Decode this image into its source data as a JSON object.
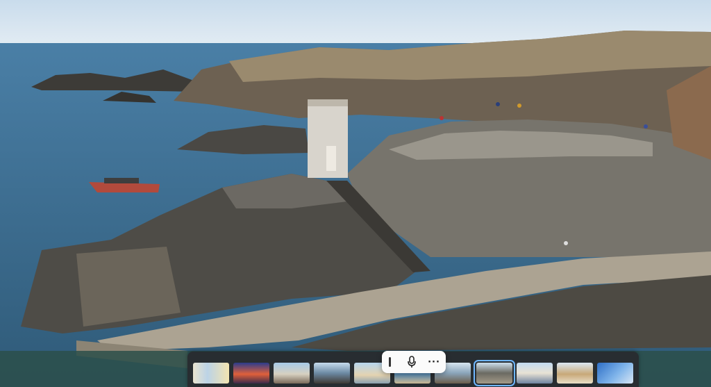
{
  "viewer": {
    "photo_icon": "landscape-photo",
    "colors": {
      "sky": "#dde9f3",
      "sea": "#3f6f94",
      "rock": "#5b5a55",
      "quay": "#a89f8f",
      "filmstrip_bg": "#28282c",
      "selection_outline": "#6fb7ff"
    }
  },
  "voice_toolbar": {
    "handle_icon": "drag-handle-icon",
    "mic_icon": "microphone-icon",
    "more_icon": "more-options-icon",
    "more_glyph": "···"
  },
  "filmstrip": {
    "selected_index": 7,
    "thumbnails": [
      {
        "icon": "map-thumbnail"
      },
      {
        "icon": "sunset-thumbnail"
      },
      {
        "icon": "harbor-thumbnail"
      },
      {
        "icon": "coast-thumbnail"
      },
      {
        "icon": "beach-thumbnail"
      },
      {
        "icon": "sea-thumbnail"
      },
      {
        "icon": "shore-thumbnail"
      },
      {
        "icon": "rocks-thumbnail"
      },
      {
        "icon": "town-thumbnail"
      },
      {
        "icon": "sand-thumbnail"
      },
      {
        "icon": "boat-thumbnail"
      }
    ]
  }
}
